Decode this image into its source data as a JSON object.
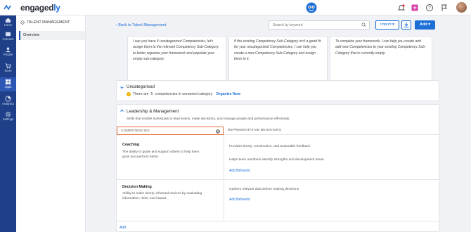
{
  "brand": {
    "logo_main": "engaged",
    "logo_accent": "ly"
  },
  "leftnav": {
    "items": [
      {
        "label": "Home",
        "icon": "home-icon"
      },
      {
        "label": "Connect",
        "icon": "connect-icon"
      },
      {
        "label": "People",
        "icon": "people-icon"
      },
      {
        "label": "Store",
        "icon": "store-icon"
      },
      {
        "label": "Apps",
        "icon": "apps-icon"
      },
      {
        "label": "Analytics",
        "icon": "analytics-icon"
      },
      {
        "label": "Settings",
        "icon": "settings-icon"
      }
    ]
  },
  "subnav": {
    "title": "TALENT MANAGEMENT",
    "selected": "Overview"
  },
  "header": {
    "back_link": "Back to Talent Management",
    "search_placeholder": "Search by keyword",
    "import_label": "Import",
    "add_label": "Add"
  },
  "tips": [
    "I see you have 4 uncategorized Competencies, let's assign them to the relevant Competency Sub-Category to better organize your framework and populate your empty sub-category.",
    "If the existing Competency Sub-Category isn't a good fit for your uncategorized Competencies, I can help you create a new Competency Sub-Category and assign them to it.",
    "To complete your framework, I can help you create and add new Competencies to your existing Competency Sub-Category that is currently empty."
  ],
  "uncategorised": {
    "title": "Uncategorised",
    "info_prefix": "There are",
    "info_count": "5",
    "info_suffix": "competencies in unnamed category",
    "organize_label": "Organize Now"
  },
  "leadership": {
    "title": "Leadership & Management",
    "description": "Skills that enable individuals to lead teams, make decisions, and manage people and performance effectively.",
    "col_competencies": "COMPETENCIES",
    "col_behaviors": "REPRESENTATIVE BEHAVIORS",
    "competencies": [
      {
        "name": "Coaching",
        "description": "The ability to guide and support others to help them grow and perform better.",
        "behaviors": [
          "Provides timely, constructive, and actionable feedback",
          "Helps team members identify strengths and development areas"
        ],
        "add_behavior": "Add Behavior"
      },
      {
        "name": "Decision Making",
        "description": "Ability to make timely, informed choices by evaluating information, risks, and impact.",
        "behaviors": [
          "Gathers relevant data before making decisions"
        ],
        "add_behavior": "Add Behavior"
      }
    ],
    "add_label": "Add"
  },
  "colors": {
    "primary": "#1d6fd8",
    "nav_bg": "#1f3f88",
    "highlight_border": "#e86a3a",
    "warning": "#f0b300"
  }
}
